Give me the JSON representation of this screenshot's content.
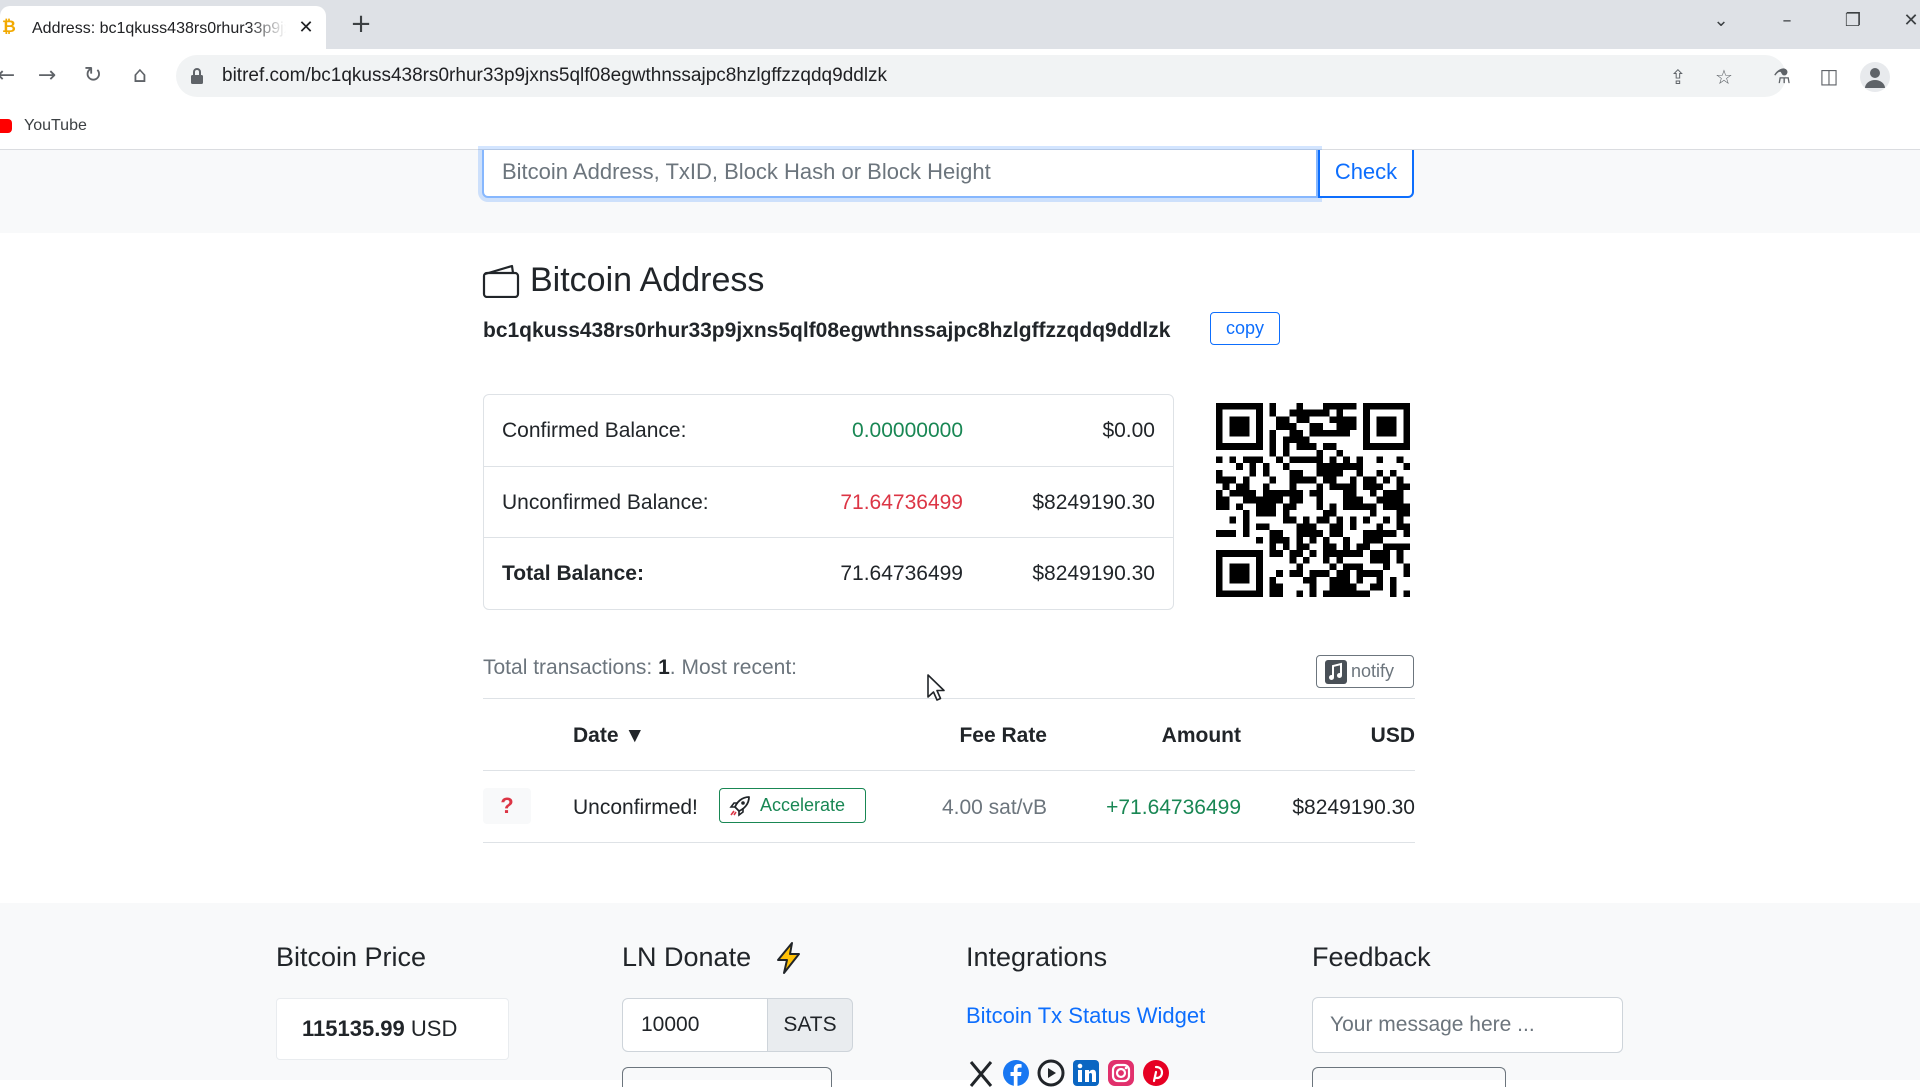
{
  "browser": {
    "tab_title": "Address: bc1qkuss438rs0rhur33p9jxns5qlf08egwthnssajpc8hzlgffzzqdq9ddlzk",
    "url": "bitref.com/bc1qkuss438rs0rhur33p9jxns5qlf08egwthnssajpc8hzlgffzzqdq9ddlzk",
    "bookmarks": [
      {
        "label": "YouTube"
      }
    ]
  },
  "search": {
    "placeholder": "Bitcoin Address, TxID, Block Hash or Block Height",
    "button_label": "Check"
  },
  "address": {
    "heading": "Bitcoin Address",
    "value": "bc1qkuss438rs0rhur33p9jxns5qlf08egwthnssajpc8hzlgffzzqdq9ddlzk",
    "copy_label": "copy"
  },
  "balances": [
    {
      "label": "Confirmed Balance:",
      "btc": "0.00000000",
      "usd": "$0.00",
      "btc_color": "#198754"
    },
    {
      "label": "Unconfirmed Balance:",
      "btc": "71.64736499",
      "usd": "$8249190.30",
      "btc_color": "#dc3545"
    },
    {
      "label": "Total Balance:",
      "btc": "71.64736499",
      "usd": "$8249190.30",
      "btc_color": "#212529"
    }
  ],
  "transactions": {
    "summary_prefix": "Total transactions: ",
    "count": "1",
    "summary_suffix": ". Most recent:",
    "notify_label": "notify",
    "columns": {
      "date": "Date ▼",
      "fee_rate": "Fee Rate",
      "amount": "Amount",
      "usd": "USD"
    },
    "rows": [
      {
        "status_icon": "?",
        "date": "Unconfirmed!",
        "accelerate_label": "Accelerate",
        "fee_rate": "4.00 sat/vB",
        "amount": "+71.64736499",
        "usd": "$8249190.30"
      }
    ]
  },
  "footer": {
    "price_title": "Bitcoin Price",
    "price_value": "115135.99",
    "price_unit": "USD",
    "donate_title": "LN Donate",
    "donate_amount": "10000",
    "donate_unit": "SATS",
    "integrations_title": "Integrations",
    "integrations_link": "Bitcoin Tx Status Widget",
    "feedback_title": "Feedback",
    "feedback_placeholder": "Your message here ..."
  },
  "colors": {
    "link": "#0d6efd",
    "success": "#198754",
    "danger": "#dc3545"
  },
  "icons": [
    "bitcoin-favicon-icon",
    "close-icon",
    "plus-icon",
    "back-icon",
    "forward-icon",
    "reload-icon",
    "home-icon",
    "lock-icon",
    "share-icon",
    "star-icon",
    "labs-icon",
    "sidepanel-icon",
    "profile-icon",
    "wallet-icon",
    "qr-code-icon",
    "music-note-icon",
    "question-icon",
    "rocket-icon",
    "lightning-icon",
    "x-icon",
    "facebook-icon",
    "youtube-icon",
    "linkedin-icon",
    "instagram-icon",
    "pinterest-icon"
  ]
}
